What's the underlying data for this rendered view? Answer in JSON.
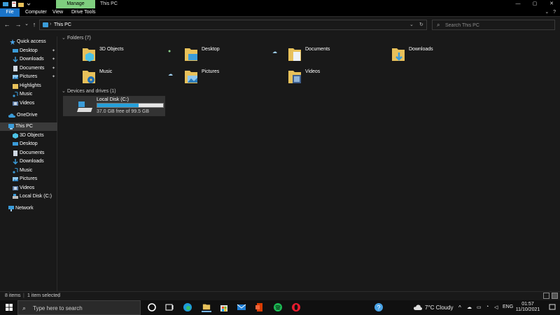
{
  "window": {
    "manage_tab": "Manage",
    "title": "This PC",
    "minimize_glyph": "—",
    "maximize_glyph": "▢",
    "close_glyph": "✕"
  },
  "ribbon": {
    "file": "File",
    "computer": "Computer",
    "view": "View",
    "drive_tools": "Drive Tools",
    "expand_glyph": "⌄",
    "help_glyph": "?"
  },
  "nav": {
    "back": "←",
    "forward": "→",
    "recent": "⌄",
    "up": "↑",
    "address_sep": "›",
    "address_path": "This PC",
    "address_dropdown": "⌄",
    "refresh": "↻",
    "search_placeholder": "Search This PC",
    "search_icon": "⌕"
  },
  "sidebar": {
    "pin_glyph": "✦",
    "items": [
      {
        "label": "Quick access",
        "icon": "star-icon"
      },
      {
        "label": "Desktop",
        "icon": "desktop-icon",
        "pinned": true
      },
      {
        "label": "Downloads",
        "icon": "download-icon",
        "pinned": true
      },
      {
        "label": "Documents",
        "icon": "document-icon",
        "pinned": true
      },
      {
        "label": "Pictures",
        "icon": "picture-icon",
        "pinned": true
      },
      {
        "label": "Highlights",
        "icon": "folder-icon"
      },
      {
        "label": "Music",
        "icon": "music-icon"
      },
      {
        "label": "Videos",
        "icon": "video-icon"
      },
      {
        "label": "OneDrive",
        "icon": "cloud-icon"
      },
      {
        "label": "This PC",
        "icon": "computer-icon",
        "selected": true
      },
      {
        "label": "3D Objects",
        "icon": "cube-icon"
      },
      {
        "label": "Desktop",
        "icon": "desktop-icon"
      },
      {
        "label": "Documents",
        "icon": "document-icon"
      },
      {
        "label": "Downloads",
        "icon": "download-icon"
      },
      {
        "label": "Music",
        "icon": "music-icon"
      },
      {
        "label": "Pictures",
        "icon": "picture-icon"
      },
      {
        "label": "Videos",
        "icon": "video-icon"
      },
      {
        "label": "Local Disk (C:)",
        "icon": "drive-icon"
      },
      {
        "label": "Network",
        "icon": "network-icon"
      }
    ]
  },
  "folders_group": {
    "label": "Folders (7)",
    "items": [
      {
        "label": "3D Objects",
        "icon": "cube-icon"
      },
      {
        "label": "Desktop",
        "icon": "desktop-icon",
        "sync": "synced"
      },
      {
        "label": "Documents",
        "icon": "document-icon",
        "sync": "cloud"
      },
      {
        "label": "Downloads",
        "icon": "download-icon"
      },
      {
        "label": "Music",
        "icon": "music-icon"
      },
      {
        "label": "Pictures",
        "icon": "picture-icon",
        "sync": "cloud"
      },
      {
        "label": "Videos",
        "icon": "video-icon"
      }
    ]
  },
  "drives_group": {
    "label": "Devices and drives (1)",
    "drive": {
      "label": "Local Disk (C:)",
      "free_text": "37.0 GB free of 99.5 GB",
      "used_fraction": 0.628
    }
  },
  "status": {
    "items_count": "8 items",
    "selection": "1 item selected"
  },
  "taskbar": {
    "search_placeholder": "Type here to search",
    "weather": "7°C  Cloudy",
    "language": "ENG",
    "time": "01:57",
    "date": "11/10/2021",
    "help_glyph": "?",
    "chevron_glyph": "^"
  },
  "colors": {
    "accent": "#1a74c9",
    "manage": "#7fce7f",
    "folder": "#e8c15a",
    "drive_fill": "#26a0da"
  }
}
